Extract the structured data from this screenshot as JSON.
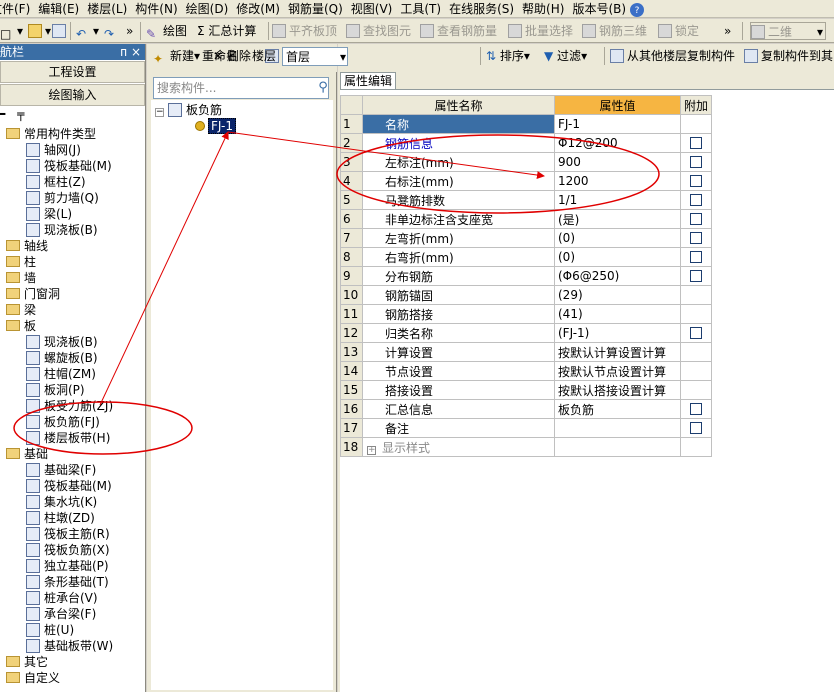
{
  "menubar": {
    "items": [
      "文件(F)",
      "编辑(E)",
      "楼层(L)",
      "构件(N)",
      "绘图(D)",
      "修改(M)",
      "钢筋量(Q)",
      "视图(V)",
      "工具(T)",
      "在线服务(S)",
      "帮助(H)",
      "版本号(B)"
    ]
  },
  "toolbar": {
    "draw": "绘图",
    "sum": "Σ 汇总计算",
    "flush_top": "平齐板顶",
    "find": "查找图元",
    "view_rebar": "查看钢筋量",
    "batch_select": "批量选择",
    "rebar_3d": "钢筋三维",
    "lock": "锁定",
    "view_2d": "二维"
  },
  "nav": {
    "title": "导航栏",
    "pin": "ᴨ",
    "close": "×",
    "btn_project": "工程设置",
    "btn_draw": "绘图输入",
    "tree": [
      {
        "label": "常用构件类型",
        "type": "folder"
      },
      {
        "label": "轴网(J)",
        "type": "item"
      },
      {
        "label": "筏板基础(M)",
        "type": "item"
      },
      {
        "label": "框柱(Z)",
        "type": "item"
      },
      {
        "label": "剪力墙(Q)",
        "type": "item"
      },
      {
        "label": "梁(L)",
        "type": "item"
      },
      {
        "label": "现浇板(B)",
        "type": "item"
      },
      {
        "label": "轴线",
        "type": "folder"
      },
      {
        "label": "柱",
        "type": "folder"
      },
      {
        "label": "墙",
        "type": "folder"
      },
      {
        "label": "门窗洞",
        "type": "folder"
      },
      {
        "label": "梁",
        "type": "folder"
      },
      {
        "label": "板",
        "type": "folder"
      },
      {
        "label": "现浇板(B)",
        "type": "item"
      },
      {
        "label": "螺旋板(B)",
        "type": "item"
      },
      {
        "label": "柱帽(ZM)",
        "type": "item"
      },
      {
        "label": "板洞(P)",
        "type": "item"
      },
      {
        "label": "板受力筋(ZJ)",
        "type": "item"
      },
      {
        "label": "板负筋(FJ)",
        "type": "item"
      },
      {
        "label": "楼层板带(H)",
        "type": "item"
      },
      {
        "label": "基础",
        "type": "folder"
      },
      {
        "label": "基础梁(F)",
        "type": "item"
      },
      {
        "label": "筏板基础(M)",
        "type": "item"
      },
      {
        "label": "集水坑(K)",
        "type": "item"
      },
      {
        "label": "柱墩(ZD)",
        "type": "item"
      },
      {
        "label": "筏板主筋(R)",
        "type": "item"
      },
      {
        "label": "筏板负筋(X)",
        "type": "item"
      },
      {
        "label": "独立基础(P)",
        "type": "item"
      },
      {
        "label": "条形基础(T)",
        "type": "item"
      },
      {
        "label": "桩承台(V)",
        "type": "item"
      },
      {
        "label": "承台梁(F)",
        "type": "item"
      },
      {
        "label": "桩(U)",
        "type": "item"
      },
      {
        "label": "基础板带(W)",
        "type": "item"
      },
      {
        "label": "其它",
        "type": "folder"
      },
      {
        "label": "自定义",
        "type": "folder"
      }
    ]
  },
  "mid": {
    "new": "新建",
    "delete": "删除",
    "copy": "复制",
    "rename": "重命名",
    "floor_label": "楼层",
    "floor_value": "首层",
    "search_placeholder": "搜索构件...",
    "search_icon": "⚲",
    "tree_root": "板负筋",
    "tree_child": "FJ-1"
  },
  "right": {
    "sort": "排序",
    "filter": "过滤",
    "copy_from": "从其他楼层复制构件",
    "copy_to": "复制构件到其",
    "tab": "属性编辑",
    "headers": {
      "name": "属性名称",
      "value": "属性值",
      "extra": "附加"
    },
    "rows": [
      {
        "n": "1",
        "name": "名称",
        "value": "FJ-1",
        "cb": false
      },
      {
        "n": "2",
        "name": "钢筋信息",
        "value": "Φ12@200",
        "cb": true
      },
      {
        "n": "3",
        "name": "左标注(mm)",
        "value": "900",
        "cb": true
      },
      {
        "n": "4",
        "name": "右标注(mm)",
        "value": "1200",
        "cb": true
      },
      {
        "n": "5",
        "name": "马凳筋排数",
        "value": "1/1",
        "cb": true
      },
      {
        "n": "6",
        "name": "非单边标注含支座宽",
        "value": "(是)",
        "cb": true
      },
      {
        "n": "7",
        "name": "左弯折(mm)",
        "value": "(0)",
        "cb": true
      },
      {
        "n": "8",
        "name": "右弯折(mm)",
        "value": "(0)",
        "cb": true
      },
      {
        "n": "9",
        "name": "分布钢筋",
        "value": "(Φ6@250)",
        "cb": true
      },
      {
        "n": "10",
        "name": "钢筋锚固",
        "value": "(29)",
        "cb": false
      },
      {
        "n": "11",
        "name": "钢筋搭接",
        "value": "(41)",
        "cb": false
      },
      {
        "n": "12",
        "name": "归类名称",
        "value": "(FJ-1)",
        "cb": true
      },
      {
        "n": "13",
        "name": "计算设置",
        "value": "按默认计算设置计算",
        "cb": false
      },
      {
        "n": "14",
        "name": "节点设置",
        "value": "按默认节点设置计算",
        "cb": false
      },
      {
        "n": "15",
        "name": "搭接设置",
        "value": "按默认搭接设置计算",
        "cb": false
      },
      {
        "n": "16",
        "name": "汇总信息",
        "value": "板负筋",
        "cb": true
      },
      {
        "n": "17",
        "name": "备注",
        "value": "",
        "cb": true
      },
      {
        "n": "18",
        "name": "显示样式",
        "value": "",
        "cb": false
      }
    ]
  },
  "colors": {
    "annotation": "#e00000",
    "selection": "#0a246a",
    "header_accent": "#f6b542",
    "title_bar": "#3a6ea5"
  }
}
